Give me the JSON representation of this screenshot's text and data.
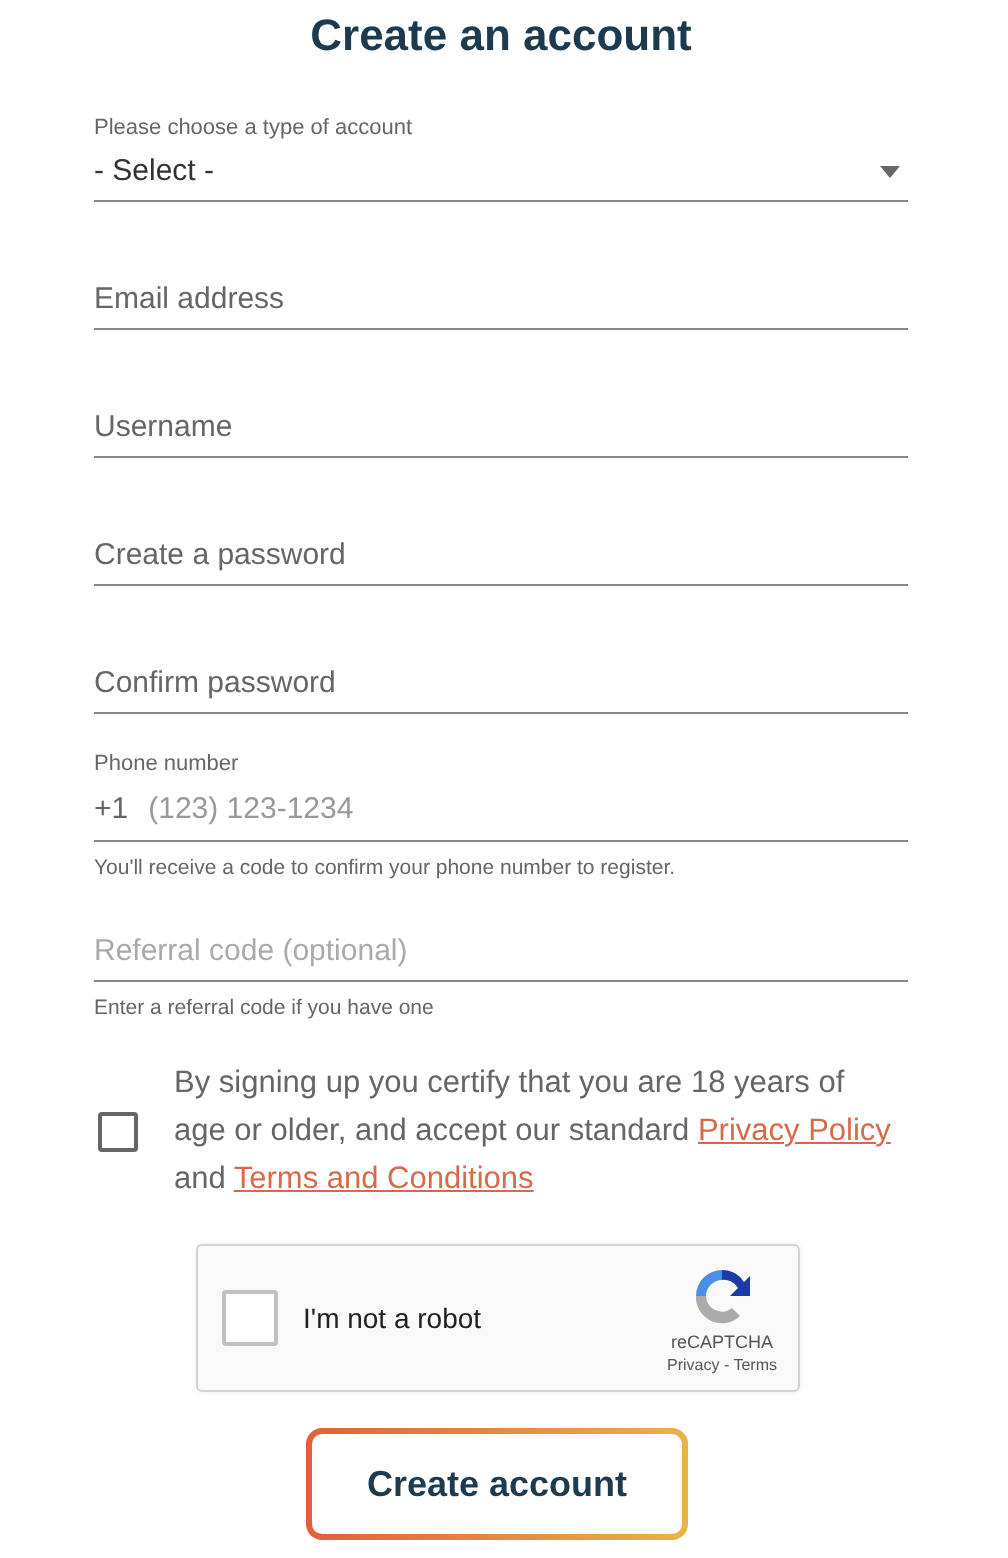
{
  "title": "Create an account",
  "fields": [
    {
      "kind": "select",
      "label": "Please choose a type of account",
      "value": "- Select -"
    },
    {
      "kind": "text",
      "placeholder": "Email address"
    },
    {
      "kind": "text",
      "placeholder": "Username"
    },
    {
      "kind": "text",
      "placeholder": "Create a password"
    },
    {
      "kind": "text",
      "placeholder": "Confirm password"
    },
    {
      "kind": "phone",
      "label": "Phone number",
      "prefix": "+1",
      "placeholder": "(123) 123-1234",
      "hint": "You'll receive a code to confirm your phone number to register."
    },
    {
      "kind": "text",
      "placeholder": "Referral code (optional)",
      "hint": "Enter a referral code if you have one"
    }
  ],
  "agreement": {
    "checked": false,
    "parts": [
      {
        "kind": "text",
        "text": "By signing up you certify that you are 18 years of age or older, and accept our standard "
      },
      {
        "kind": "link",
        "text": "Privacy Policy"
      },
      {
        "kind": "text",
        "text": " and "
      },
      {
        "kind": "link",
        "text": "Terms and Conditions"
      }
    ]
  },
  "captcha": {
    "checked": false,
    "label": "I'm not a robot",
    "brand": "reCAPTCHA",
    "links": "Privacy - Terms"
  },
  "submit": "Create account"
}
